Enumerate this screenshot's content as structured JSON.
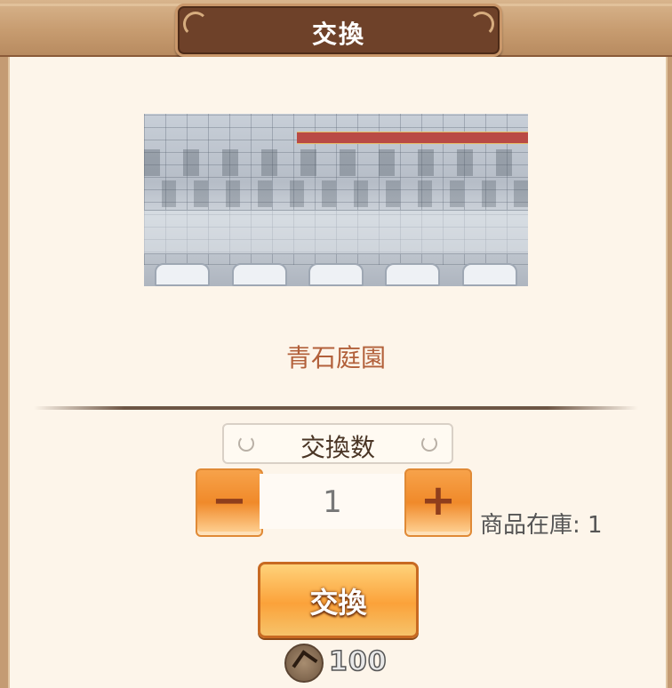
{
  "header": {
    "title": "交換"
  },
  "item": {
    "name": "青石庭園",
    "preview_icon": "stone-garden-image"
  },
  "quantity": {
    "label": "交換数",
    "value": "1",
    "minus_label": "−",
    "plus_label": "+"
  },
  "stock": {
    "text": "商品在庫: 1"
  },
  "exchange_button": {
    "label": "交換"
  },
  "cost": {
    "icon": "coin-icon",
    "value": "100"
  },
  "colors": {
    "accent": "#f39a3c",
    "title_plate": "#6e4129",
    "item_name": "#b2603a"
  }
}
